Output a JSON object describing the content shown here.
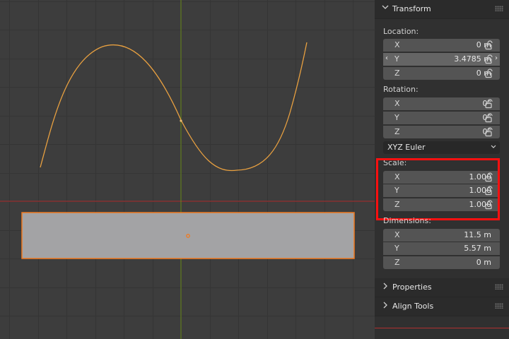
{
  "panel": {
    "transform_header": "Transform",
    "location_label": "Location:",
    "location": [
      {
        "axis": "X",
        "value": "0 m"
      },
      {
        "axis": "Y",
        "value": "3.4785 m"
      },
      {
        "axis": "Z",
        "value": "0 m"
      }
    ],
    "rotation_label": "Rotation:",
    "rotation": [
      {
        "axis": "X",
        "value": "0°"
      },
      {
        "axis": "Y",
        "value": "0°"
      },
      {
        "axis": "Z",
        "value": "0°"
      }
    ],
    "rotation_mode": "XYZ Euler",
    "scale_label": "Scale:",
    "scale": [
      {
        "axis": "X",
        "value": "1.000"
      },
      {
        "axis": "Y",
        "value": "1.000"
      },
      {
        "axis": "Z",
        "value": "1.000"
      }
    ],
    "dimensions_label": "Dimensions:",
    "dimensions": [
      {
        "axis": "X",
        "value": "11.5 m"
      },
      {
        "axis": "Y",
        "value": "5.57 m"
      },
      {
        "axis": "Z",
        "value": "0 m"
      }
    ],
    "properties_header": "Properties",
    "align_tools_header": "Align Tools"
  },
  "colors": {
    "curve": "#e8a040",
    "selected_outline": "#f07a20",
    "x_axis": "#b03030",
    "y_axis": "#6b8a1a",
    "highlight_box": "#ff1010"
  },
  "icons": {
    "header_chevron_open": "chevron-down-icon",
    "header_chevron_closed": "chevron-right-icon",
    "lock": "unlock-icon",
    "grip": "drag-grip-icon"
  }
}
